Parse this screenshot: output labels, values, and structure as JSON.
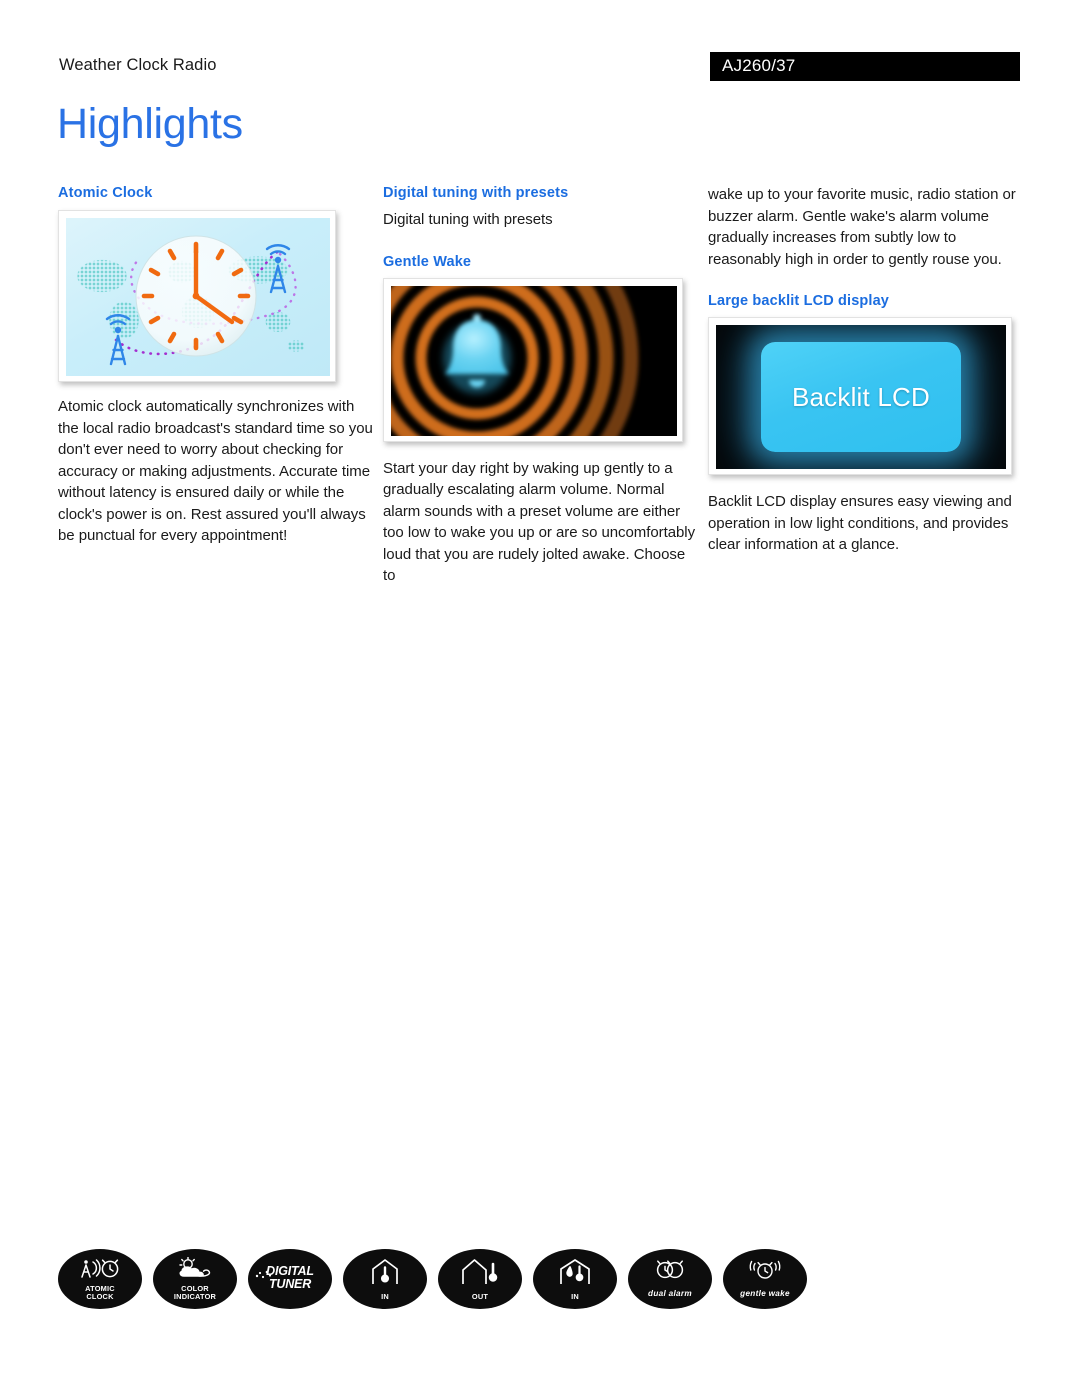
{
  "header": {
    "product_line": "Weather Clock Radio",
    "model": "AJ260/37"
  },
  "title": "Highlights",
  "accent_color": "#2a72e5",
  "heading_color": "#1b6de0",
  "columns": {
    "left": {
      "heading": "Atomic Clock",
      "image_alt": "atomic-clock-illustration",
      "body": "Atomic clock automatically synchronizes with the local radio broadcast's standard time so you don't ever need to worry about checking for accuracy or making adjustments. Accurate time without latency is ensured daily or while the clock's power is on. Rest assured you'll always be punctual for every appointment!"
    },
    "middle": {
      "heading_1": "Digital tuning with presets",
      "body_1": "Digital tuning with presets",
      "heading_2": "Gentle Wake",
      "image_alt": "gentle-wake-bell-illustration",
      "body_2": "Start your day right by waking up gently to a gradually escalating alarm volume. Normal alarm sounds with a preset volume are either too low to wake you up or are so uncomfortably loud that you are rudely jolted awake. Choose to"
    },
    "right": {
      "body_1": "wake up to your favorite music, radio station or buzzer alarm. Gentle wake's alarm volume gradually increases from subtly low to reasonably high in order to gently rouse you.",
      "heading": "Large backlit LCD display",
      "image_alt": "backlit-lcd-illustration",
      "lcd_screen_text": "Backlit LCD",
      "body_2": "Backlit LCD display ensures easy viewing and operation in low light conditions, and provides clear information at a glance."
    }
  },
  "badges": [
    {
      "id": "atomic-clock",
      "icon": "atomic-clock-icon",
      "line1": "ATOMIC",
      "line2": "CLOCK",
      "style": "caps"
    },
    {
      "id": "color-indicator",
      "icon": "sun-cloud-icon",
      "line1": "COLOR",
      "line2": "INDICATOR",
      "style": "caps"
    },
    {
      "id": "digital-tuner",
      "icon": "digital-tuner-wordmark",
      "line1": "DIGITAL",
      "line2": "TUNER",
      "style": "wordmark"
    },
    {
      "id": "indoor-temp",
      "icon": "house-thermometer-in-icon",
      "line1": "IN",
      "line2": "",
      "style": "caps"
    },
    {
      "id": "outdoor-temp",
      "icon": "house-thermometer-out-icon",
      "line1": "OUT",
      "line2": "",
      "style": "caps"
    },
    {
      "id": "indoor-humidity",
      "icon": "house-humidity-icon",
      "line1": "IN",
      "line2": "",
      "style": "caps"
    },
    {
      "id": "dual-alarm",
      "icon": "dual-alarm-clock-icon",
      "line1": "dual alarm",
      "line2": "",
      "style": "script"
    },
    {
      "id": "gentle-wake",
      "icon": "gentle-wake-clock-icon",
      "line1": "gentle wake",
      "line2": "",
      "style": "script"
    }
  ]
}
